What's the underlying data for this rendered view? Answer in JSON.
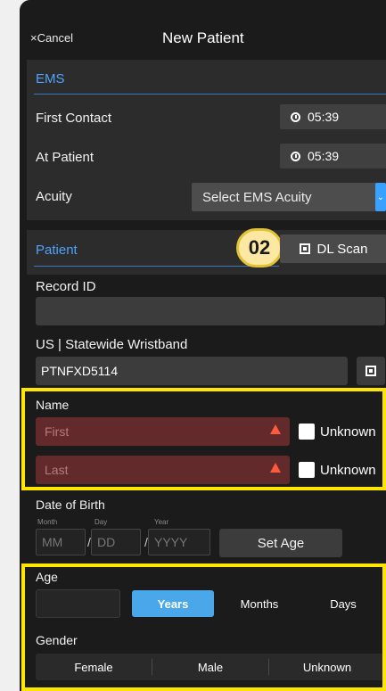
{
  "header": {
    "cancel_label": "Cancel",
    "cancel_icon": "×",
    "title": "New Patient"
  },
  "ems": {
    "section_title": "EMS",
    "first_contact": {
      "label": "First Contact",
      "time": "05:39"
    },
    "at_patient": {
      "label": "At Patient",
      "time": "05:39"
    },
    "acuity": {
      "label": "Acuity",
      "value": "Select EMS Acuity"
    }
  },
  "patient": {
    "section_title": "Patient",
    "badge": "02",
    "scan_button": "DL Scan",
    "record_id_label": "Record ID",
    "record_id_value": "",
    "wristband_label": "US | Statewide Wristband",
    "wristband_value": "PTNFXD5114"
  },
  "name": {
    "label": "Name",
    "first_placeholder": "First",
    "last_placeholder": "Last",
    "unknown_label": "Unknown"
  },
  "dob": {
    "label": "Date of Birth",
    "month_caption": "Month",
    "day_caption": "Day",
    "year_caption": "Year",
    "month_placeholder": "MM",
    "day_placeholder": "DD",
    "year_placeholder": "YYYY",
    "separator": "/",
    "set_age_label": "Set Age"
  },
  "age": {
    "label": "Age",
    "units": [
      "Years",
      "Months",
      "Days"
    ],
    "selected_unit": "Years"
  },
  "gender": {
    "label": "Gender",
    "options": [
      "Female",
      "Male",
      "Unknown"
    ]
  },
  "colors": {
    "accent": "#4da3ff",
    "highlight": "#ffe600",
    "error_fill": "#622a2a",
    "warning": "#ff5a3c",
    "segment_active": "#4aa7ea"
  }
}
